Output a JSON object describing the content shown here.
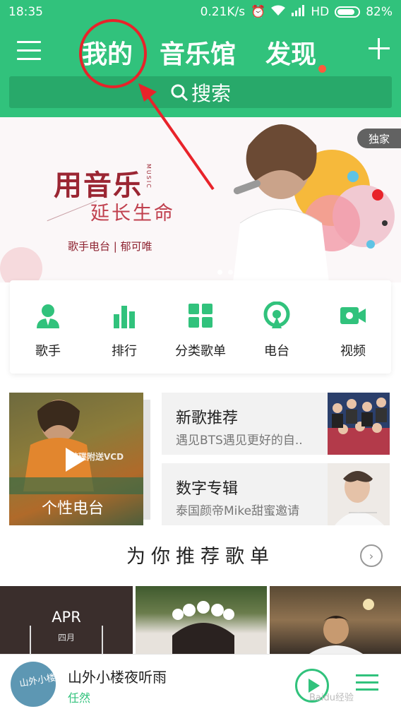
{
  "status_bar": {
    "time": "18:35",
    "speed": "0.21K/s",
    "network": "HD",
    "battery": "82%"
  },
  "header": {
    "tabs": [
      {
        "label": "我的"
      },
      {
        "label": "音乐馆"
      },
      {
        "label": "发现"
      }
    ],
    "search_label": "搜索"
  },
  "banner": {
    "title": "用音乐",
    "side_text": "MUSIC",
    "subtitle": "延长生命",
    "caption": "歌手电台 | 郁可唯",
    "badge": "独家"
  },
  "categories": [
    {
      "label": "歌手",
      "icon": "singer-icon"
    },
    {
      "label": "排行",
      "icon": "chart-icon"
    },
    {
      "label": "分类歌单",
      "icon": "category-icon"
    },
    {
      "label": "电台",
      "icon": "radio-icon"
    },
    {
      "label": "视频",
      "icon": "video-icon"
    }
  ],
  "personal_radio": {
    "label": "个性电台",
    "cover_text": "随碟附送VCD"
  },
  "new_songs": {
    "title": "新歌推荐",
    "subtitle": "遇见BTS遇见更好的自.."
  },
  "digital_album": {
    "title": "数字专辑",
    "subtitle": "泰国颜帝Mike甜蜜邀请"
  },
  "recommend_section": {
    "title": "为你推荐歌单",
    "arrow": "›"
  },
  "playlists": [
    {
      "month": "APR",
      "month_cn": "四月"
    }
  ],
  "player": {
    "song": "山外小楼夜听雨",
    "artist": "任然",
    "art_text": "山外小楼"
  },
  "watermark": "Baidu经验",
  "colors": {
    "brand_green": "#31c27c",
    "annotation_red": "#e8232a"
  }
}
